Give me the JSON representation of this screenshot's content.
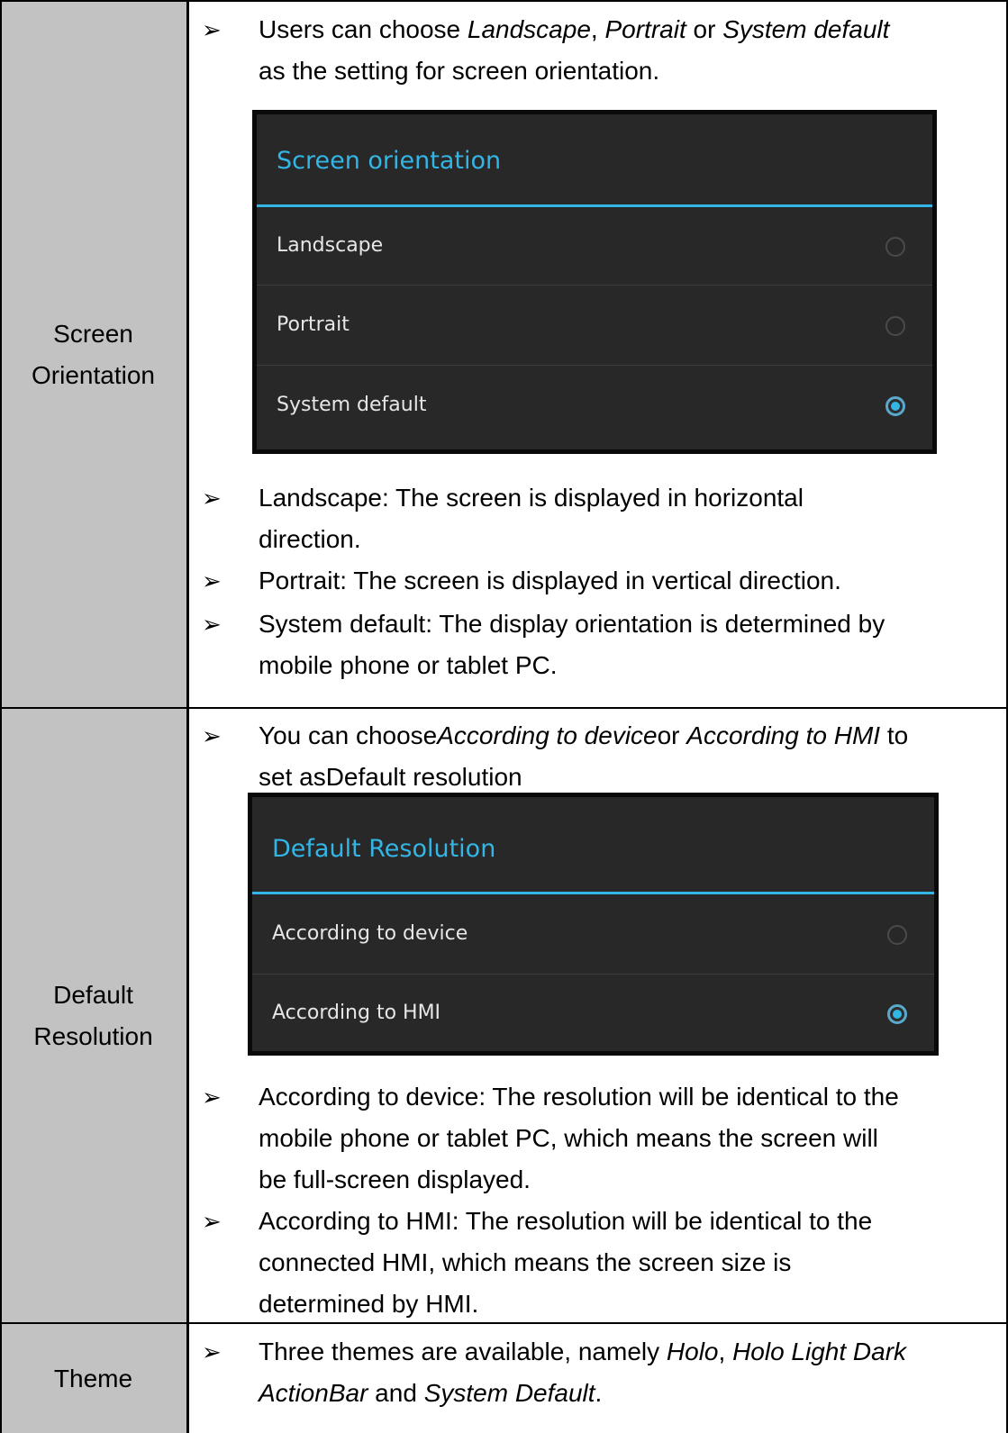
{
  "accent_color": "#33b5e5",
  "label_cell_color": "#c2c2c2",
  "rows": [
    {
      "label_lines": [
        "Screen",
        "Orientation"
      ],
      "intro": {
        "parts": [
          {
            "t": "Users can choose ",
            "i": false
          },
          {
            "t": "Landscape",
            "i": true
          },
          {
            "t": ", ",
            "i": false
          },
          {
            "t": "Portrait",
            "i": true
          },
          {
            "t": " or ",
            "i": false
          },
          {
            "t": "System default",
            "i": true
          }
        ],
        "line2": "as the setting for screen orientation."
      },
      "dialog": {
        "title": "Screen orientation",
        "options": [
          {
            "label": "Landscape",
            "selected": false
          },
          {
            "label": "Portrait",
            "selected": false
          },
          {
            "label": "System default",
            "selected": true
          }
        ]
      },
      "notes": [
        [
          "Landscape: The screen is displayed in horizontal",
          "direction."
        ],
        [
          "Portrait: The screen is displayed in vertical direction."
        ],
        [
          "System default: The display orientation is determined by",
          "mobile phone or tablet PC."
        ]
      ]
    },
    {
      "label_lines": [
        "Default",
        "Resolution"
      ],
      "intro": {
        "parts": [
          {
            "t": "You can choose",
            "i": false
          },
          {
            "t": "According to device",
            "i": true
          },
          {
            "t": "or ",
            "i": false
          },
          {
            "t": "According to HMI",
            "i": true
          },
          {
            "t": " to",
            "i": false
          }
        ],
        "line2": "set asDefault resolution"
      },
      "dialog": {
        "title": "Default Resolution",
        "options": [
          {
            "label": "According to device",
            "selected": false
          },
          {
            "label": "According to HMI",
            "selected": true
          }
        ]
      },
      "notes": [
        [
          "According to device: The resolution will be identical to the",
          "mobile phone or tablet PC, which means the screen will",
          "be full-screen displayed."
        ],
        [
          "According to HMI: The resolution will be identical to the",
          "connected HMI, which means the screen size is",
          "determined by HMI."
        ]
      ]
    },
    {
      "label_lines": [
        "Theme"
      ],
      "intro": {
        "parts": [
          {
            "t": "Three themes are available, namely ",
            "i": false
          },
          {
            "t": "Holo",
            "i": true
          },
          {
            "t": ", ",
            "i": false
          },
          {
            "t": "Holo Light Dark",
            "i": true
          }
        ],
        "line2_parts": [
          {
            "t": "ActionBar",
            "i": true
          },
          {
            "t": " and ",
            "i": false
          },
          {
            "t": "System Default",
            "i": true
          },
          {
            "t": ".",
            "i": false
          }
        ]
      }
    }
  ]
}
